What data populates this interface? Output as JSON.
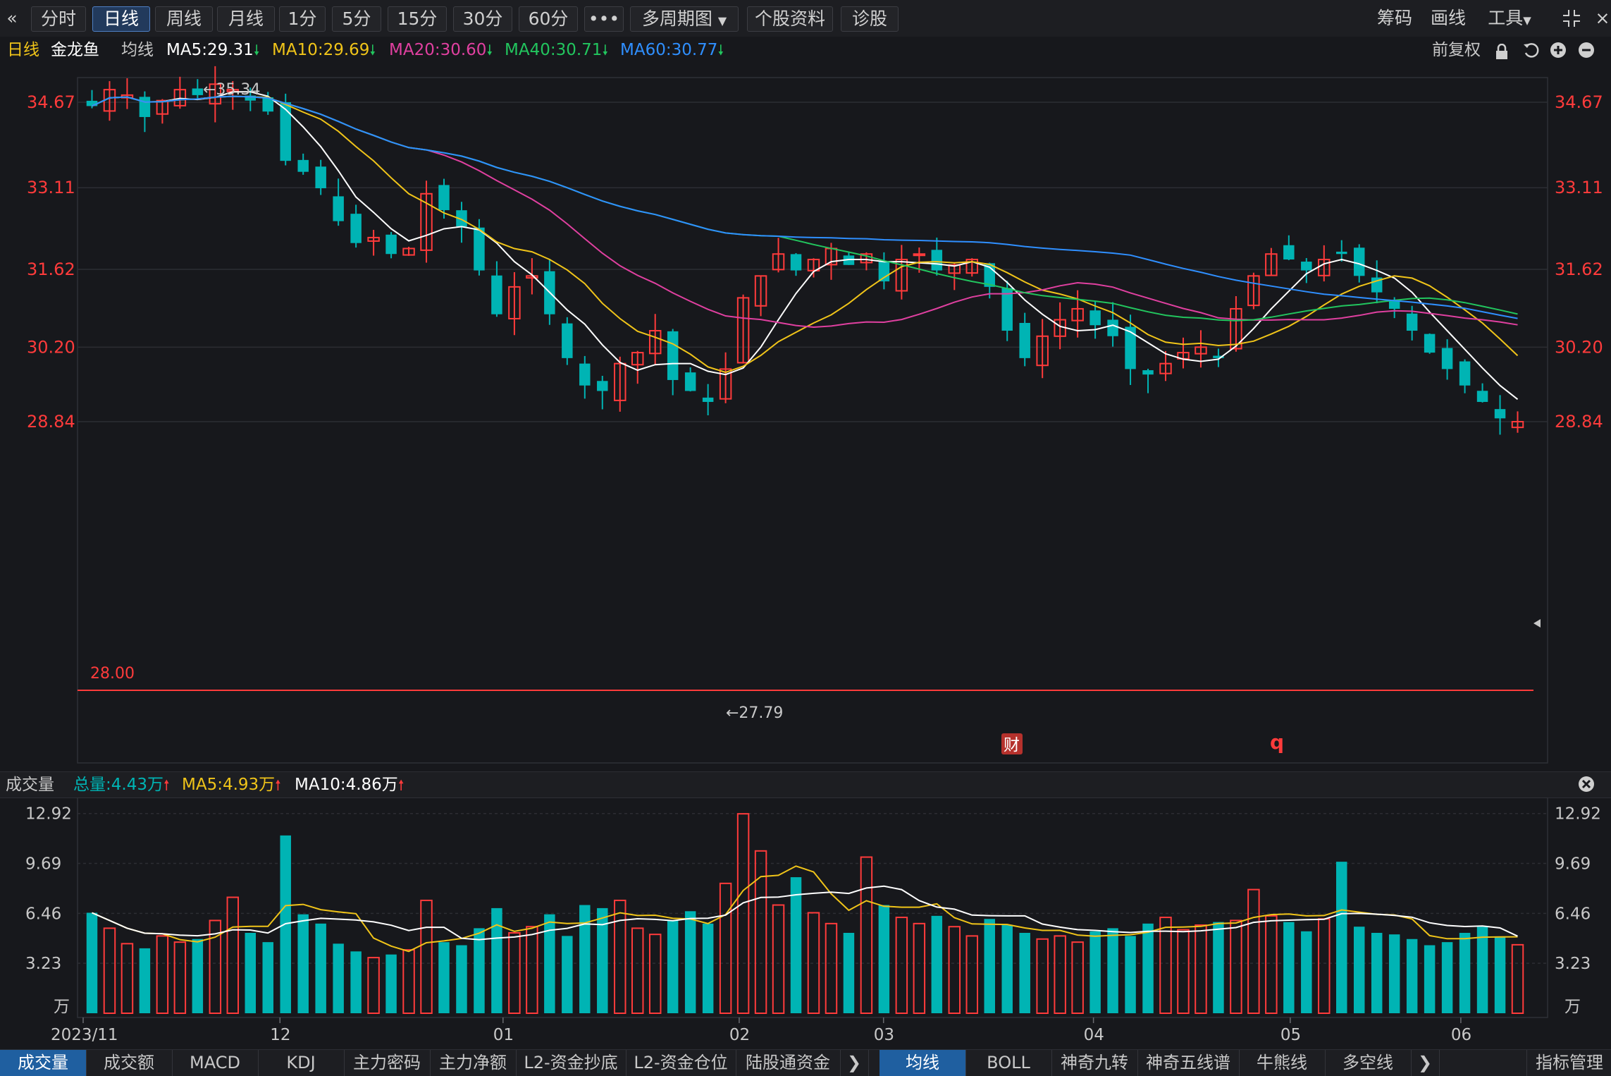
{
  "toolbar": {
    "collapse_icon": "double-chevron-left-icon",
    "periods": [
      "分时",
      "日线",
      "周线",
      "月线",
      "1分",
      "5分",
      "15分",
      "30分",
      "60分"
    ],
    "active_period": "日线",
    "more_label": "•••",
    "multi_period_label": "多周期图",
    "stock_info_label": "个股资料",
    "diagnose_label": "诊股",
    "right_items": [
      "筹码",
      "画线",
      "工具"
    ],
    "shrink_icon": "shrink-icon"
  },
  "ma_header": {
    "period_label": "日线",
    "stock_name": "金龙鱼",
    "ma_title": "均线",
    "ma5": "MA5:29.31",
    "ma10": "MA10:29.69",
    "ma20": "MA20:30.60",
    "ma40": "MA40:30.71",
    "ma60": "MA60:30.77",
    "adjust_label": "前复权",
    "icons": [
      "lock-icon",
      "undo-icon",
      "zoom-in-icon",
      "zoom-out-icon"
    ]
  },
  "colors": {
    "up": "#ff3b3b",
    "down": "#00b4b4",
    "ma5": "#ffffff",
    "ma10": "#f0c419",
    "ma20": "#e040a0",
    "ma40": "#22c55e",
    "ma60": "#2f8fff",
    "accent": "#4e7fc4"
  },
  "price_chart": {
    "y_ticks": [
      "34.67",
      "33.11",
      "31.62",
      "30.20",
      "28.84"
    ],
    "high_label": "←35.34",
    "low_label": "←27.79",
    "line_label": "28.00",
    "fin_marker": "财",
    "q_marker": "q"
  },
  "volume_header": {
    "title": "成交量",
    "total": "总量:4.43万",
    "ma5": "MA5:4.93万",
    "ma10": "MA10:4.86万",
    "close_icon": "close-icon"
  },
  "volume_chart": {
    "y_ticks": [
      "12.92",
      "9.69",
      "6.46",
      "3.23"
    ],
    "unit": "万",
    "x_ticks": [
      "2023/11",
      "12",
      "01",
      "02",
      "03",
      "04",
      "05",
      "06"
    ]
  },
  "bottom_tabs": {
    "left": [
      "成交量",
      "成交额",
      "MACD",
      "KDJ",
      "主力密码",
      "主力净额",
      "L2-资金抄底",
      "L2-资金仓位",
      "陆股通资金"
    ],
    "right": [
      "均线",
      "BOLL",
      "神奇九转",
      "神奇五线谱",
      "牛熊线",
      "多空线"
    ],
    "manage_label": "指标管理",
    "active_left": "成交量",
    "active_right": "均线"
  },
  "chart_data": {
    "type": "candlestick",
    "stock": "金龙鱼",
    "period": "日线",
    "x_ticks": [
      "2023/11",
      "12",
      "01",
      "02",
      "03",
      "04",
      "05",
      "06"
    ],
    "y_ticks": [
      34.67,
      33.11,
      31.62,
      30.2,
      28.84
    ],
    "ylim": [
      27.2,
      35.6
    ],
    "high": 35.34,
    "low": 27.79,
    "reference_line": 28.0,
    "last_close": 28.84,
    "ma_last": {
      "MA5": 29.31,
      "MA10": 29.69,
      "MA20": 30.6,
      "MA40": 30.71,
      "MA60": 30.77
    },
    "close_trend": [
      34.6,
      34.9,
      34.8,
      34.4,
      34.7,
      34.9,
      34.8,
      35.0,
      34.9,
      34.7,
      34.5,
      33.6,
      33.4,
      33.1,
      32.5,
      32.1,
      32.2,
      31.9,
      32.0,
      33.0,
      32.7,
      32.4,
      31.6,
      30.8,
      31.3,
      31.5,
      30.8,
      30.0,
      29.5,
      29.4,
      29.9,
      30.1,
      30.5,
      29.6,
      29.4,
      29.2,
      29.8,
      31.1,
      31.5,
      31.9,
      31.6,
      31.8,
      32.0,
      31.7,
      31.9,
      31.4,
      31.8,
      31.9,
      31.6,
      31.7,
      31.8,
      31.3,
      30.5,
      30.0,
      30.4,
      30.7,
      30.9,
      30.6,
      30.4,
      29.8,
      29.7,
      29.9,
      30.1,
      30.2,
      30.0,
      30.9,
      31.5,
      31.9,
      31.8,
      31.6,
      31.8,
      31.9,
      31.5,
      31.2,
      30.9,
      30.5,
      30.1,
      29.8,
      29.5,
      29.2,
      28.9,
      28.84
    ],
    "volume_ylim": [
      0,
      13.5
    ],
    "volume_unit": "万",
    "volume_trend": [
      6.5,
      5.5,
      4.5,
      4.2,
      5.0,
      4.6,
      4.8,
      6.0,
      7.5,
      5.2,
      4.6,
      11.5,
      6.4,
      5.8,
      4.5,
      4.0,
      3.6,
      3.8,
      4.1,
      7.3,
      4.6,
      4.4,
      5.5,
      6.8,
      5.2,
      5.6,
      6.4,
      5.0,
      7.0,
      6.8,
      7.3,
      5.5,
      5.1,
      6.0,
      6.6,
      5.8,
      8.4,
      12.9,
      10.5,
      7.0,
      8.8,
      6.5,
      5.8,
      5.2,
      10.1,
      7.0,
      6.2,
      5.8,
      6.3,
      5.6,
      5.0,
      6.1,
      5.7,
      5.2,
      4.8,
      5.0,
      4.6,
      5.3,
      5.5,
      5.0,
      5.8,
      6.2,
      5.4,
      5.7,
      5.9,
      6.0,
      8.0,
      6.3,
      5.9,
      5.3,
      6.1,
      9.8,
      5.6,
      5.2,
      5.1,
      4.8,
      4.4,
      4.6,
      5.2,
      5.6,
      4.9,
      4.43
    ]
  }
}
